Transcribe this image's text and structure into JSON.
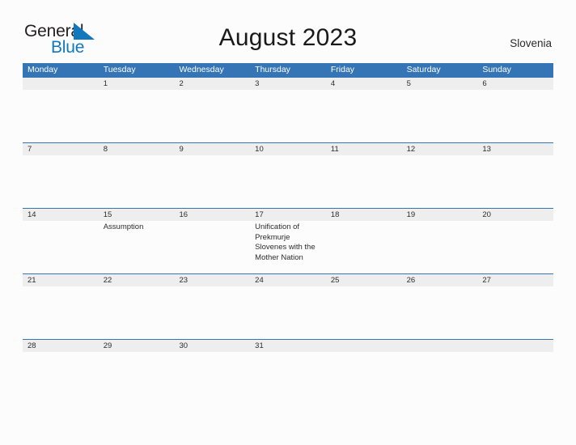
{
  "branding": {
    "logo_word1": "General",
    "logo_word2": "Blue",
    "logo_icon": "blue-flag-triangle",
    "logo_word1_color": "#231f20",
    "logo_word2_color": "#1278be"
  },
  "header": {
    "title": "August 2023",
    "region": "Slovenia"
  },
  "colors": {
    "header_blue": "#3575b5",
    "row_band_gray": "#eeeeee",
    "page_background": "#fcfcfc",
    "text": "#2c2c2c"
  },
  "calendar": {
    "month": "August",
    "year": "2023",
    "weekday_headers": [
      "Monday",
      "Tuesday",
      "Wednesday",
      "Thursday",
      "Friday",
      "Saturday",
      "Sunday"
    ],
    "weeks": [
      {
        "days": [
          {
            "date": "",
            "event": ""
          },
          {
            "date": "1",
            "event": ""
          },
          {
            "date": "2",
            "event": ""
          },
          {
            "date": "3",
            "event": ""
          },
          {
            "date": "4",
            "event": ""
          },
          {
            "date": "5",
            "event": ""
          },
          {
            "date": "6",
            "event": ""
          }
        ]
      },
      {
        "days": [
          {
            "date": "7",
            "event": ""
          },
          {
            "date": "8",
            "event": ""
          },
          {
            "date": "9",
            "event": ""
          },
          {
            "date": "10",
            "event": ""
          },
          {
            "date": "11",
            "event": ""
          },
          {
            "date": "12",
            "event": ""
          },
          {
            "date": "13",
            "event": ""
          }
        ]
      },
      {
        "days": [
          {
            "date": "14",
            "event": ""
          },
          {
            "date": "15",
            "event": "Assumption"
          },
          {
            "date": "16",
            "event": ""
          },
          {
            "date": "17",
            "event": "Unification of Prekmurje Slovenes with the Mother Nation"
          },
          {
            "date": "18",
            "event": ""
          },
          {
            "date": "19",
            "event": ""
          },
          {
            "date": "20",
            "event": ""
          }
        ]
      },
      {
        "days": [
          {
            "date": "21",
            "event": ""
          },
          {
            "date": "22",
            "event": ""
          },
          {
            "date": "23",
            "event": ""
          },
          {
            "date": "24",
            "event": ""
          },
          {
            "date": "25",
            "event": ""
          },
          {
            "date": "26",
            "event": ""
          },
          {
            "date": "27",
            "event": ""
          }
        ]
      },
      {
        "days": [
          {
            "date": "28",
            "event": ""
          },
          {
            "date": "29",
            "event": ""
          },
          {
            "date": "30",
            "event": ""
          },
          {
            "date": "31",
            "event": ""
          },
          {
            "date": "",
            "event": ""
          },
          {
            "date": "",
            "event": ""
          },
          {
            "date": "",
            "event": ""
          }
        ]
      }
    ]
  }
}
